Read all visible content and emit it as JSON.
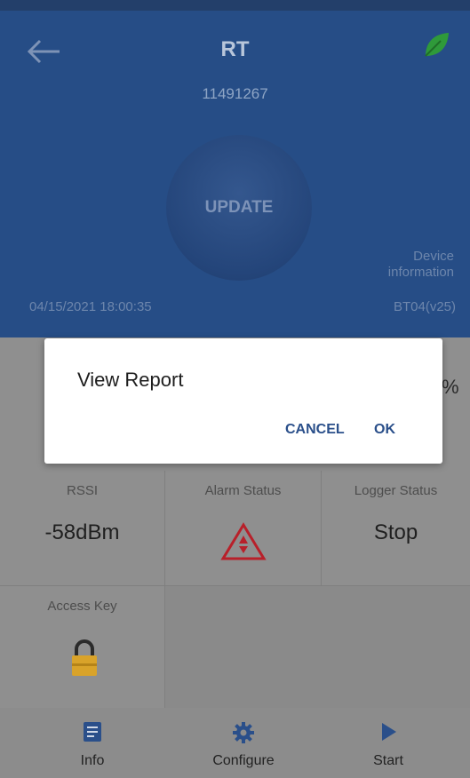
{
  "header": {
    "title": "RT",
    "serial": "11491267",
    "update_label": "UPDATE",
    "device_info_label": "Device information",
    "timestamp": "04/15/2021 18:00:35",
    "firmware": "BT04(v25)"
  },
  "hidden_value_suffix": "%",
  "cells": {
    "rssi_label": "RSSI",
    "rssi_value": "-58dBm",
    "alarm_label": "Alarm Status",
    "logger_label": "Logger Status",
    "logger_value": "Stop",
    "access_label": "Access Key"
  },
  "nav": {
    "info": "Info",
    "configure": "Configure",
    "start": "Start"
  },
  "dialog": {
    "title": "View Report",
    "cancel": "CANCEL",
    "ok": "OK"
  },
  "colors": {
    "header_bg": "#264d86",
    "dim_overlay": "#8f8f8f",
    "dialog_accent": "#2a4f8a",
    "leaf": "#2f9a3a",
    "alarm": "#b8202a",
    "lock": "#d9a32a"
  }
}
